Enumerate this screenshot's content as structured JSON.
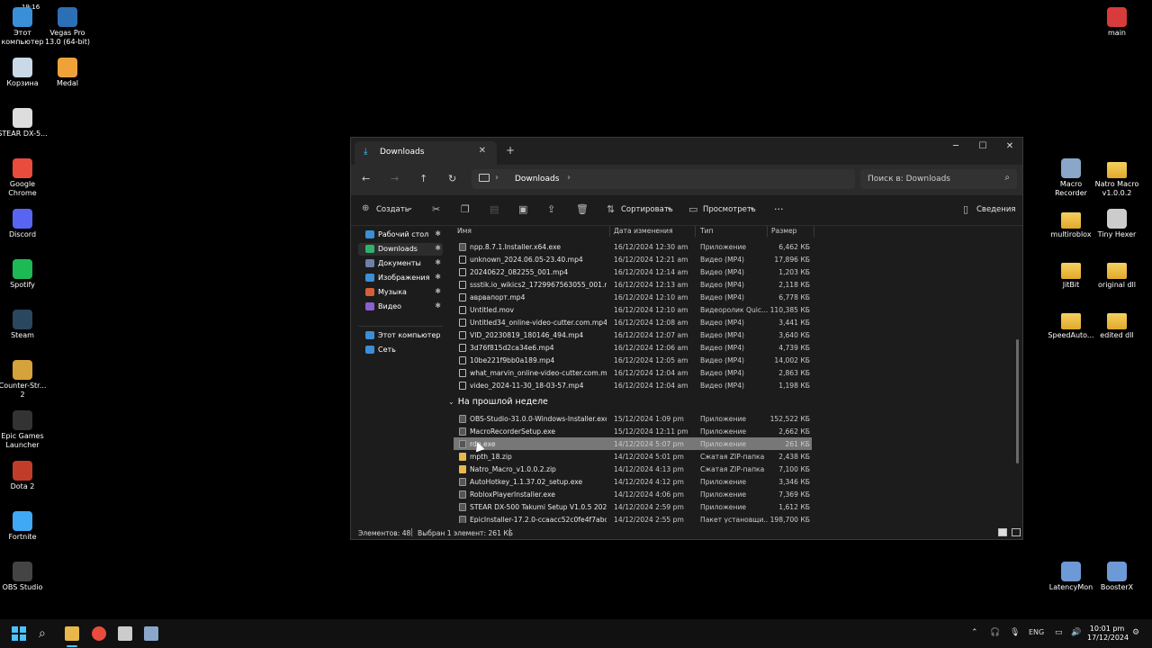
{
  "desktop": {
    "icons_left": [
      {
        "label": "Этот компьютер",
        "icon": "computer-icon",
        "color": "#3a8fd8"
      },
      {
        "label": "Vegas Pro 13.0 (64-bit)",
        "icon": "vegas-icon",
        "color": "#2d6fb5"
      },
      {
        "label": "Корзина",
        "icon": "recycle-bin-icon",
        "color": "#c9d9e8"
      },
      {
        "label": "Medal",
        "icon": "medal-icon",
        "color": "#f0a23a"
      },
      {
        "label": "STEAR DX-5...",
        "icon": "stear-icon",
        "color": "#dddddd"
      },
      {
        "label": "Google Chrome",
        "icon": "chrome-icon",
        "color": "#e94b3c"
      },
      {
        "label": "Discord",
        "icon": "discord-icon",
        "color": "#5865f2"
      },
      {
        "label": "Spotify",
        "icon": "spotify-icon",
        "color": "#1db954"
      },
      {
        "label": "Steam",
        "icon": "steam-icon",
        "color": "#2a475e"
      },
      {
        "label": "Counter-Str... 2",
        "icon": "counter-strike-icon",
        "color": "#d6a23a"
      },
      {
        "label": "Epic Games Launcher",
        "icon": "epic-games-icon",
        "color": "#333333"
      },
      {
        "label": "Dota 2",
        "icon": "dota-icon",
        "color": "#c23c2a"
      },
      {
        "label": "Fortnite",
        "icon": "fortnite-icon",
        "color": "#3fa9f5"
      },
      {
        "label": "OBS Studio",
        "icon": "obs-icon",
        "color": "#444444"
      }
    ],
    "icons_right": [
      {
        "label": "main",
        "icon": "main-icon",
        "color": "#d83b3b"
      },
      {
        "label": "Macro Recorder",
        "icon": "macro-recorder-icon",
        "color": "#8aa6c8"
      },
      {
        "label": "Natro Macro v1.0.0.2",
        "icon": "folder-icon",
        "color": "#e8b94a"
      },
      {
        "label": "multiroblox",
        "icon": "folder-icon",
        "color": "#e8b94a"
      },
      {
        "label": "Tiny Hexer",
        "icon": "tiny-hexer-icon",
        "color": "#cccccc"
      },
      {
        "label": "JitBit",
        "icon": "folder-icon",
        "color": "#e8b94a"
      },
      {
        "label": "original dll",
        "icon": "folder-icon",
        "color": "#e8b94a"
      },
      {
        "label": "SpeedAuto...",
        "icon": "folder-icon",
        "color": "#e8b94a"
      },
      {
        "label": "edited dll",
        "icon": "folder-icon",
        "color": "#e8b94a"
      },
      {
        "label": "LatencyMon",
        "icon": "latencymon-icon",
        "color": "#6d9ad6"
      },
      {
        "label": "BoosterX",
        "icon": "boosterx-icon",
        "color": "#6d9ad6"
      }
    ],
    "top_left_time": "19:16"
  },
  "window": {
    "tab_title": "Downloads",
    "tab_close": "✕",
    "new_tab": "+",
    "minimize": "─",
    "maximize": "☐",
    "close": "✕",
    "nav": {
      "back": "←",
      "forward": "→",
      "up": "↑",
      "refresh": "↻",
      "chevron": "›"
    },
    "address_segment": "Downloads",
    "search_placeholder": "Поиск в: Downloads",
    "toolbar": {
      "create": "Создать",
      "sort": "Сортировать",
      "view": "Просмотреть",
      "more": "···",
      "details": "Сведения",
      "dropdown": "⌄"
    },
    "sidebar": [
      {
        "label": "Рабочий стол",
        "pinned": true,
        "color": "#3a8fd8"
      },
      {
        "label": "Downloads",
        "pinned": true,
        "color": "#2fb36b",
        "active": true
      },
      {
        "label": "Документы",
        "pinned": true,
        "color": "#6f7fa8"
      },
      {
        "label": "Изображения",
        "pinned": true,
        "color": "#3a8fd8"
      },
      {
        "label": "Музыка",
        "pinned": true,
        "color": "#d2603a"
      },
      {
        "label": "Видео",
        "pinned": true,
        "color": "#8a5fd1"
      },
      {
        "label": "Этот компьютер",
        "pinned": false,
        "color": "#3a8fd8"
      },
      {
        "label": "Сеть",
        "pinned": false,
        "color": "#3a8fd8"
      }
    ],
    "pin_glyph": "✱",
    "columns": {
      "name": "Имя",
      "date": "Дата изменения",
      "type": "Тип",
      "size": "Размер"
    },
    "rows_top": [
      {
        "name": "npp.8.7.1.Installer.x64.exe",
        "date": "16/12/2024 12:30 am",
        "type": "Приложение",
        "size": "6,462 КБ",
        "kind": "app"
      },
      {
        "name": "unknown_2024.06.05-23.40.mp4",
        "date": "16/12/2024 12:21 am",
        "type": "Видео (MP4)",
        "size": "17,896 КБ",
        "kind": "file"
      },
      {
        "name": "20240622_082255_001.mp4",
        "date": "16/12/2024 12:14 am",
        "type": "Видео (MP4)",
        "size": "1,203 КБ",
        "kind": "file"
      },
      {
        "name": "ssstik.io_wikics2_1729967563055_001.mp4",
        "date": "16/12/2024 12:13 am",
        "type": "Видео (MP4)",
        "size": "2,118 КБ",
        "kind": "file"
      },
      {
        "name": "аврвапорт.mp4",
        "date": "16/12/2024 12:10 am",
        "type": "Видео (MP4)",
        "size": "6,778 КБ",
        "kind": "file"
      },
      {
        "name": "Untitled.mov",
        "date": "16/12/2024 12:10 am",
        "type": "Видеоролик Quic...",
        "size": "110,385 КБ",
        "kind": "file"
      },
      {
        "name": "Untitled34_online-video-cutter.com.mp4",
        "date": "16/12/2024 12:08 am",
        "type": "Видео (MP4)",
        "size": "3,441 КБ",
        "kind": "file"
      },
      {
        "name": "VID_20230819_180146_494.mp4",
        "date": "16/12/2024 12:07 am",
        "type": "Видео (MP4)",
        "size": "3,640 КБ",
        "kind": "file"
      },
      {
        "name": "3d76f815d2ca34e6.mp4",
        "date": "16/12/2024 12:06 am",
        "type": "Видео (MP4)",
        "size": "4,739 КБ",
        "kind": "file"
      },
      {
        "name": "10be221f9bb0a189.mp4",
        "date": "16/12/2024 12:05 am",
        "type": "Видео (MP4)",
        "size": "14,002 КБ",
        "kind": "file"
      },
      {
        "name": "what_marvin_online-video-cutter.com.m...",
        "date": "16/12/2024 12:04 am",
        "type": "Видео (MP4)",
        "size": "2,863 КБ",
        "kind": "file"
      },
      {
        "name": "video_2024-11-30_18-03-57.mp4",
        "date": "16/12/2024 12:04 am",
        "type": "Видео (MP4)",
        "size": "1,198 КБ",
        "kind": "file"
      }
    ],
    "group_label": "На прошлой неделе",
    "group_chevron": "⌄",
    "rows_bottom": [
      {
        "name": "OBS-Studio-31.0.0-Windows-Installer.exe",
        "date": "15/12/2024 1:09 pm",
        "type": "Приложение",
        "size": "152,522 КБ",
        "kind": "app"
      },
      {
        "name": "MacroRecorderSetup.exe",
        "date": "15/12/2024 12:11 pm",
        "type": "Приложение",
        "size": "2,662 КБ",
        "kind": "app"
      },
      {
        "name": "rdp.exe",
        "date": "14/12/2024 5:07 pm",
        "type": "Приложение",
        "size": "261 КБ",
        "kind": "app",
        "selected": true
      },
      {
        "name": "mpth_18.zip",
        "date": "14/12/2024 5:01 pm",
        "type": "Сжатая ZIP-папка",
        "size": "2,438 КБ",
        "kind": "zip"
      },
      {
        "name": "Natro_Macro_v1.0.0.2.zip",
        "date": "14/12/2024 4:13 pm",
        "type": "Сжатая ZIP-папка",
        "size": "7,100 КБ",
        "kind": "zip"
      },
      {
        "name": "AutoHotkey_1.1.37.02_setup.exe",
        "date": "14/12/2024 4:12 pm",
        "type": "Приложение",
        "size": "3,346 КБ",
        "kind": "app"
      },
      {
        "name": "RobloxPlayerInstaller.exe",
        "date": "14/12/2024 4:06 pm",
        "type": "Приложение",
        "size": "7,369 КБ",
        "kind": "app"
      },
      {
        "name": "STEAR DX-500 Takumi Setup V1.0.5 20231...",
        "date": "14/12/2024 2:59 pm",
        "type": "Приложение",
        "size": "1,612 КБ",
        "kind": "app"
      },
      {
        "name": "EpicInstaller-17.2.0-ccaacc52c0fe4f7abce...",
        "date": "14/12/2024 2:55 pm",
        "type": "Пакет установщи...",
        "size": "198,700 КБ",
        "kind": "app"
      }
    ],
    "status": {
      "count": "Элементов: 48",
      "selected": "Выбран 1 элемент: 261 КБ"
    }
  },
  "taskbar": {
    "lang": "ENG",
    "time": "10:01 pm",
    "date": "17/12/2024",
    "tray_up": "⌃"
  }
}
